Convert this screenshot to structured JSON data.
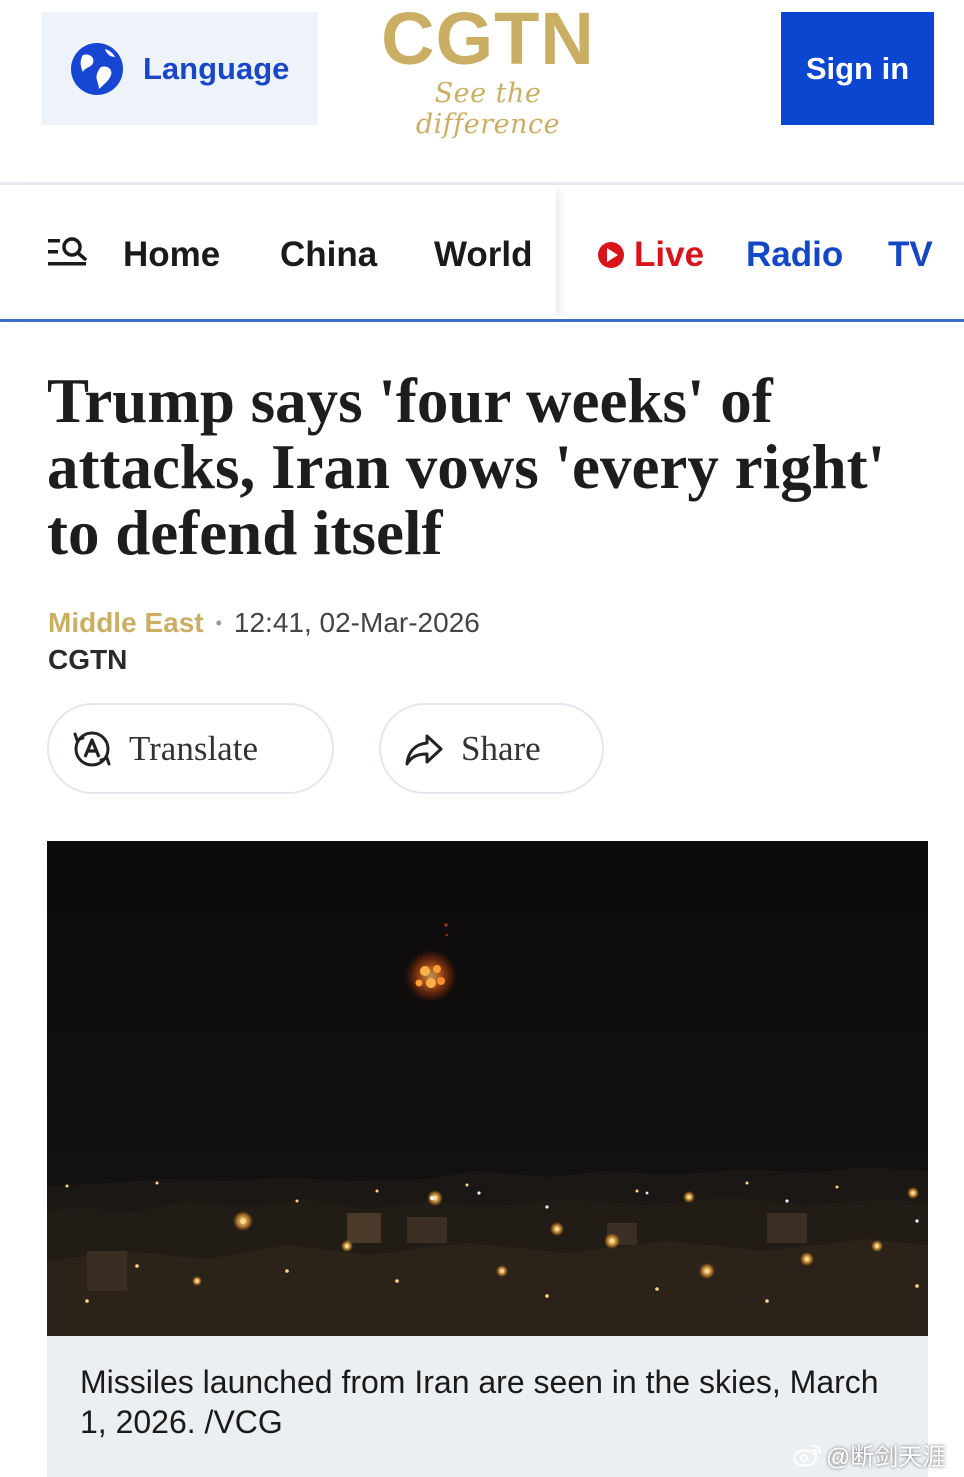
{
  "header": {
    "language_label": "Language",
    "logo_text": "CGTN",
    "logo_tagline": "See the difference",
    "signin_label": "Sign in",
    "brand_gold": "#c9ae63",
    "brand_blue": "#0b46d1"
  },
  "nav": {
    "menu_icon": "menu-search-icon",
    "items": [
      {
        "label": "Home"
      },
      {
        "label": "China"
      },
      {
        "label": "World"
      },
      {
        "label": "Live",
        "icon": "live-dot-icon",
        "color": "#d7141a"
      },
      {
        "label": "Radio",
        "color": "#1447c4"
      },
      {
        "label": "TV",
        "color": "#1447c4"
      }
    ]
  },
  "article": {
    "headline": "Trump says 'four weeks' of attacks, Iran vows 'every right' to defend itself",
    "section": "Middle East",
    "separator": "•",
    "timestamp": "12:41, 02-Mar-2026",
    "source": "CGTN",
    "translate_label": "Translate",
    "share_label": "Share",
    "image_caption": "Missiles launched from Iran are seen in the skies, March 1, 2026. /VCG"
  },
  "watermark": {
    "text": "@断剑天涯"
  }
}
